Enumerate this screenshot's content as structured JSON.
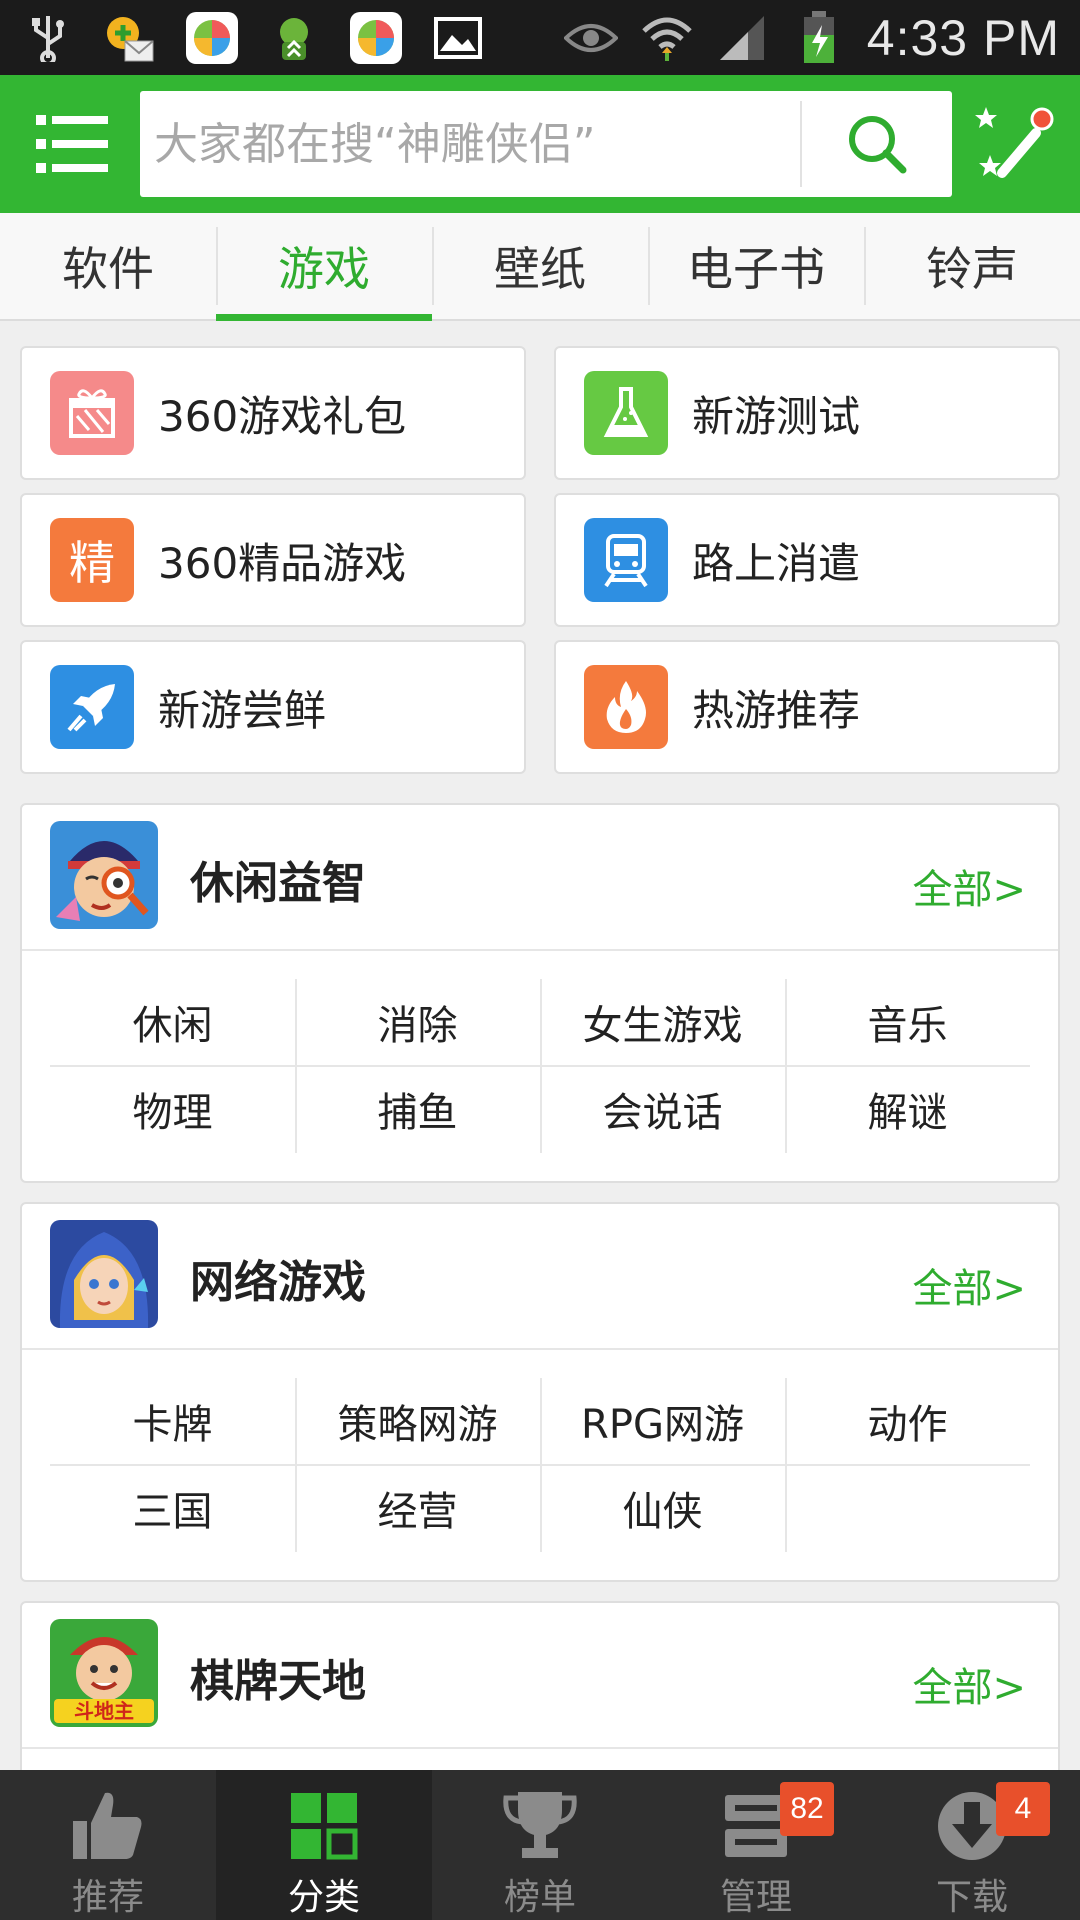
{
  "status_bar": {
    "time": "4:33 PM",
    "icons": [
      "usb-icon",
      "mail-app-icon",
      "360-app-icon",
      "robot-app-icon",
      "360-app-icon",
      "image-icon",
      "eye-icon",
      "wifi-icon",
      "signal-icon",
      "battery-charging-icon"
    ]
  },
  "header": {
    "search_placeholder": "大家都在搜“神雕侠侣”",
    "icons": {
      "menu": "menu-icon",
      "search": "search-icon",
      "tools": "magic-wand-icon"
    },
    "accent_color": "#33b633"
  },
  "tabs": [
    {
      "label": "软件",
      "active": false
    },
    {
      "label": "游戏",
      "active": true
    },
    {
      "label": "壁纸",
      "active": false
    },
    {
      "label": "电子书",
      "active": false
    },
    {
      "label": "铃声",
      "active": false
    }
  ],
  "quick_links": [
    {
      "label": "360游戏礼包",
      "icon": "gift-icon",
      "color": "#f58a8a"
    },
    {
      "label": "新游测试",
      "icon": "flask-icon",
      "color": "#66c943"
    },
    {
      "label": "360精品游戏",
      "icon": "jing-icon",
      "icon_text": "精",
      "color": "#f47a3d"
    },
    {
      "label": "路上消遣",
      "icon": "train-icon",
      "color": "#2e8fe2"
    },
    {
      "label": "新游尝鲜",
      "icon": "rocket-icon",
      "color": "#2e8fe2"
    },
    {
      "label": "热游推荐",
      "icon": "fire-icon",
      "color": "#f47a3d"
    }
  ],
  "categories": [
    {
      "title": "休闲益智",
      "all_label": "全部>",
      "rows": [
        [
          "休闲",
          "消除",
          "女生游戏",
          "音乐"
        ],
        [
          "物理",
          "捕鱼",
          "会说话",
          "解谜"
        ]
      ]
    },
    {
      "title": "网络游戏",
      "all_label": "全部>",
      "rows": [
        [
          "卡牌",
          "策略网游",
          "RPG网游",
          "动作"
        ],
        [
          "三国",
          "经营",
          "仙侠",
          ""
        ]
      ]
    },
    {
      "title": "棋牌天地",
      "all_label": "全部>",
      "thumb_text": "斗地主"
    }
  ],
  "bottom_nav": [
    {
      "label": "推荐",
      "icon": "thumbs-up-icon",
      "active": false
    },
    {
      "label": "分类",
      "icon": "grid-icon",
      "active": true
    },
    {
      "label": "榜单",
      "icon": "trophy-icon",
      "active": false
    },
    {
      "label": "管理",
      "icon": "manage-icon",
      "active": false,
      "badge": "82"
    },
    {
      "label": "下载",
      "icon": "download-icon",
      "active": false,
      "badge": "4"
    }
  ]
}
